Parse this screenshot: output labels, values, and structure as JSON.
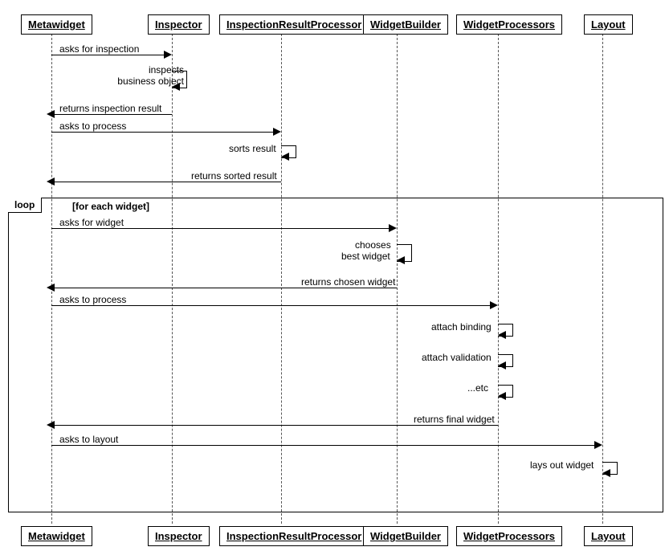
{
  "participants": {
    "metawidget": "Metawidget",
    "inspector": "Inspector",
    "irp": "InspectionResultProcessor",
    "widgetbuilder": "WidgetBuilder",
    "widgetprocessors": "WidgetProcessors",
    "layout": "Layout"
  },
  "messages": {
    "asks_inspection": "asks for inspection",
    "inspects_bo1": "inspects",
    "inspects_bo2": "business object",
    "returns_inspection": "returns inspection result",
    "asks_process": "asks to process",
    "sorts_result": "sorts result",
    "returns_sorted": "returns sorted result",
    "asks_widget": "asks for widget",
    "chooses1": "chooses",
    "chooses2": "best widget",
    "returns_chosen": "returns chosen widget",
    "asks_process2": "asks to process",
    "attach_binding": "attach binding",
    "attach_validation": "attach validation",
    "etc": "...etc",
    "returns_final": "returns final widget",
    "asks_layout": "asks to layout",
    "lays_out": "lays out widget"
  },
  "loop": {
    "tag": "loop",
    "guard": "[for each widget]"
  },
  "chart_data": {
    "type": "sequence-diagram",
    "participants": [
      "Metawidget",
      "Inspector",
      "InspectionResultProcessor",
      "WidgetBuilder",
      "WidgetProcessors",
      "Layout"
    ],
    "interactions": [
      {
        "from": "Metawidget",
        "to": "Inspector",
        "label": "asks for inspection"
      },
      {
        "from": "Inspector",
        "to": "Inspector",
        "label": "inspects business object"
      },
      {
        "from": "Inspector",
        "to": "Metawidget",
        "label": "returns inspection result"
      },
      {
        "from": "Metawidget",
        "to": "InspectionResultProcessor",
        "label": "asks to process"
      },
      {
        "from": "InspectionResultProcessor",
        "to": "InspectionResultProcessor",
        "label": "sorts result"
      },
      {
        "from": "InspectionResultProcessor",
        "to": "Metawidget",
        "label": "returns sorted result"
      },
      {
        "fragment": "loop",
        "guard": "for each widget",
        "messages": [
          {
            "from": "Metawidget",
            "to": "WidgetBuilder",
            "label": "asks for widget"
          },
          {
            "from": "WidgetBuilder",
            "to": "WidgetBuilder",
            "label": "chooses best widget"
          },
          {
            "from": "WidgetBuilder",
            "to": "Metawidget",
            "label": "returns chosen widget"
          },
          {
            "from": "Metawidget",
            "to": "WidgetProcessors",
            "label": "asks to process"
          },
          {
            "from": "WidgetProcessors",
            "to": "WidgetProcessors",
            "label": "attach binding"
          },
          {
            "from": "WidgetProcessors",
            "to": "WidgetProcessors",
            "label": "attach validation"
          },
          {
            "from": "WidgetProcessors",
            "to": "WidgetProcessors",
            "label": "...etc"
          },
          {
            "from": "WidgetProcessors",
            "to": "Metawidget",
            "label": "returns final widget"
          },
          {
            "from": "Metawidget",
            "to": "Layout",
            "label": "asks to layout"
          },
          {
            "from": "Layout",
            "to": "Layout",
            "label": "lays out widget"
          }
        ]
      }
    ]
  }
}
